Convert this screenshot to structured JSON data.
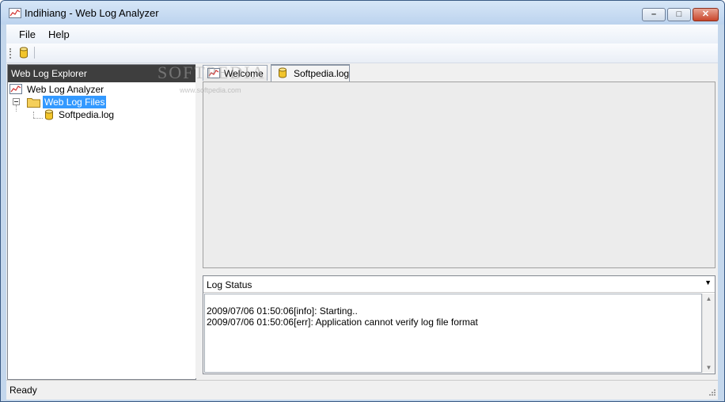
{
  "window": {
    "title": "Indihiang - Web Log Analyzer",
    "buttons": {
      "minimize": "–",
      "maximize": "□",
      "close": "✕"
    }
  },
  "menu": {
    "items": [
      "File",
      "Help"
    ]
  },
  "toolbar": {
    "buttons": [
      {
        "icon": "database-icon"
      }
    ]
  },
  "explorer": {
    "title": "Web Log Explorer",
    "tree": [
      {
        "label": "Web Log Analyzer",
        "icon": "chart-icon",
        "level": 0
      },
      {
        "label": "Web Log Files",
        "icon": "folder-icon",
        "level": 1,
        "selected": true,
        "expanded": true
      },
      {
        "label": "Softpedia.log",
        "icon": "database-icon",
        "level": 2
      }
    ]
  },
  "tabs": [
    {
      "label": "Welcome",
      "icon": "chart-icon",
      "active": false
    },
    {
      "label": "Softpedia.log",
      "icon": "database-icon",
      "active": true
    }
  ],
  "log_status": {
    "title": "Log Status",
    "lines": [
      "2009/07/06 01:50:06[info]: Starting..",
      "2009/07/06 01:50:06[err]: Application cannot verify log file format"
    ]
  },
  "status": {
    "text": "Ready"
  },
  "watermark": {
    "text": "SOFTPEDIA",
    "url": "www.softpedia.com"
  },
  "colors": {
    "selection": "#3399ff",
    "explorer_header": "#3e3e3e",
    "frame": "#c4d7ec"
  }
}
